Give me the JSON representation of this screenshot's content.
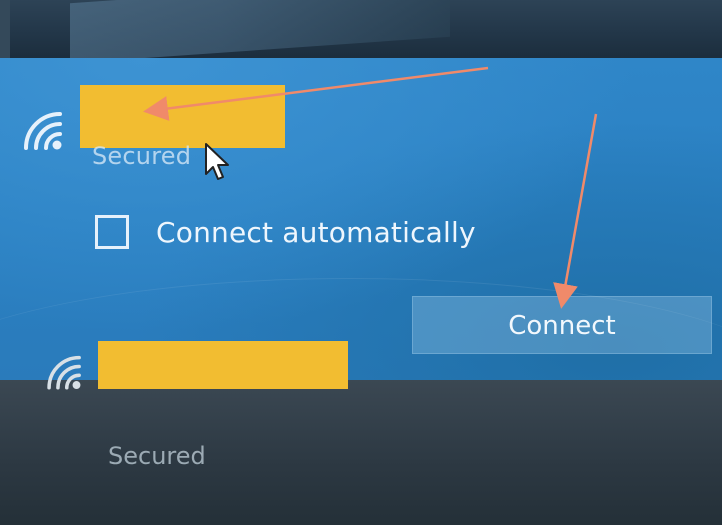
{
  "networks": [
    {
      "status": "Secured",
      "selected": true,
      "connect_automatically_label": "Connect automatically",
      "connect_automatically_checked": false,
      "connect_button_label": "Connect",
      "icon": "wifi-icon"
    },
    {
      "status": "Secured",
      "selected": false,
      "icon": "wifi-icon"
    }
  ],
  "colors": {
    "selected_bg": "#2f86c8",
    "other_bg": "#2c3842",
    "redaction": "#f2bd31",
    "annotation_arrow": "#f08a6a"
  }
}
